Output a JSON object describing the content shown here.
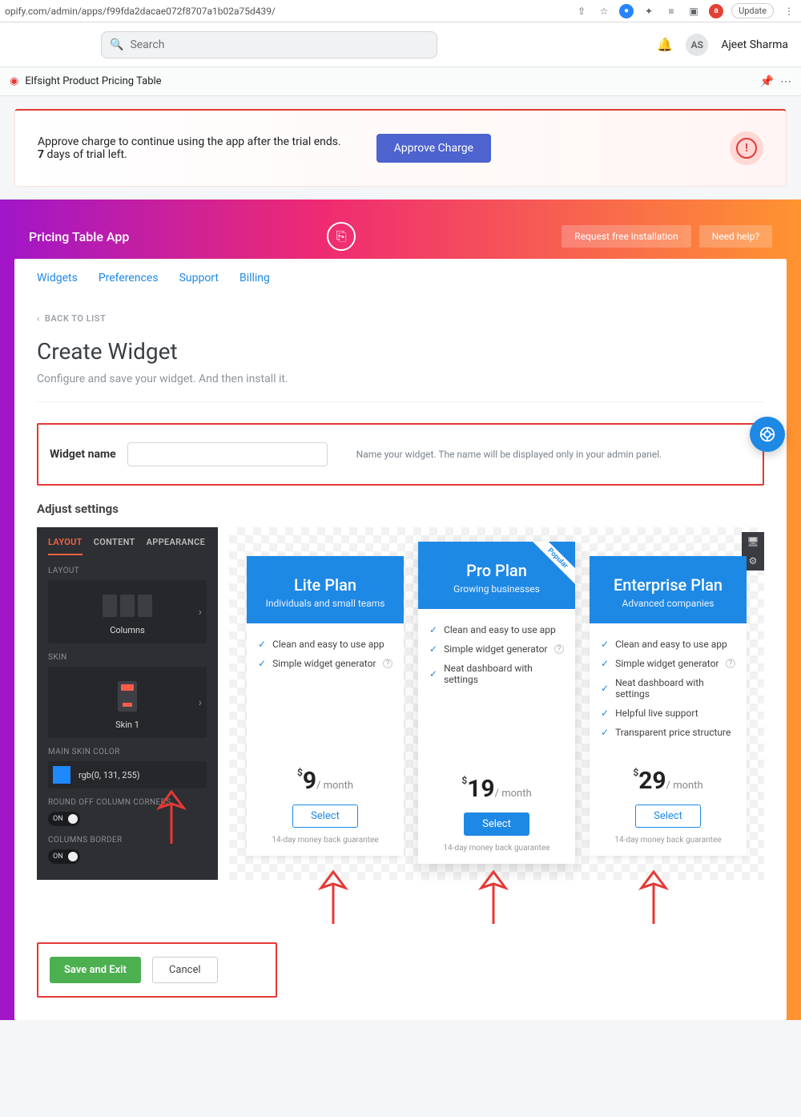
{
  "browser": {
    "url": "opify.com/admin/apps/f99fda2dacae072f8707a1b02a75d439/",
    "update": "Update",
    "profile_initial": "a"
  },
  "shopify": {
    "search_placeholder": "Search",
    "user_initials": "AS",
    "user_name": "Ajeet Sharma"
  },
  "appbar": {
    "name": "Elfsight Product Pricing Table"
  },
  "notice": {
    "line1": "Approve charge to continue using the app after the trial ends.",
    "days_prefix": "7",
    "days_rest": " days of trial left.",
    "approve": "Approve Charge"
  },
  "hero": {
    "title": "Pricing Table App",
    "install": "Request free installation",
    "help": "Need help?"
  },
  "tabs": [
    "Widgets",
    "Preferences",
    "Support",
    "Billing"
  ],
  "page": {
    "back": "BACK TO LIST",
    "title": "Create Widget",
    "subtitle": "Configure and save your widget. And then install it.",
    "widget_name_label": "Widget name",
    "widget_name_hint": "Name your widget. The name will be displayed only in your admin panel.",
    "adjust": "Adjust settings"
  },
  "sidebar": {
    "tabs": [
      "LAYOUT",
      "CONTENT",
      "APPEARANCE"
    ],
    "layout_label": "LAYOUT",
    "layout_option": "Columns",
    "skin_label": "SKIN",
    "skin_option": "Skin 1",
    "color_label": "MAIN SKIN COLOR",
    "color_value": "rgb(0, 131, 255)",
    "round_label": "ROUND OFF COLUMN CORNERS",
    "border_label": "COLUMNS BORDER",
    "toggle_on": "ON"
  },
  "plans": [
    {
      "name": "Lite Plan",
      "sub": "Individuals and small teams",
      "features": [
        "Clean and easy to use app",
        "Simple widget generator"
      ],
      "currency": "$",
      "price": "9",
      "period": "/  month",
      "select": "Select",
      "guarantee": "14-day money back guarantee"
    },
    {
      "name": "Pro Plan",
      "sub": "Growing businesses",
      "ribbon": "Popular",
      "features": [
        "Clean and easy to use app",
        "Simple widget generator",
        "Neat dashboard with settings"
      ],
      "currency": "$",
      "price": "19",
      "period": "/  month",
      "select": "Select",
      "guarantee": "14-day money back guarantee"
    },
    {
      "name": "Enterprise Plan",
      "sub": "Advanced companies",
      "features": [
        "Clean and easy to use app",
        "Simple widget generator",
        "Neat dashboard with settings",
        "Helpful live support",
        "Transparent price structure"
      ],
      "currency": "$",
      "price": "29",
      "period": "/  month",
      "select": "Select",
      "guarantee": "14-day money back guarantee"
    }
  ],
  "footer": {
    "save": "Save and Exit",
    "cancel": "Cancel"
  }
}
